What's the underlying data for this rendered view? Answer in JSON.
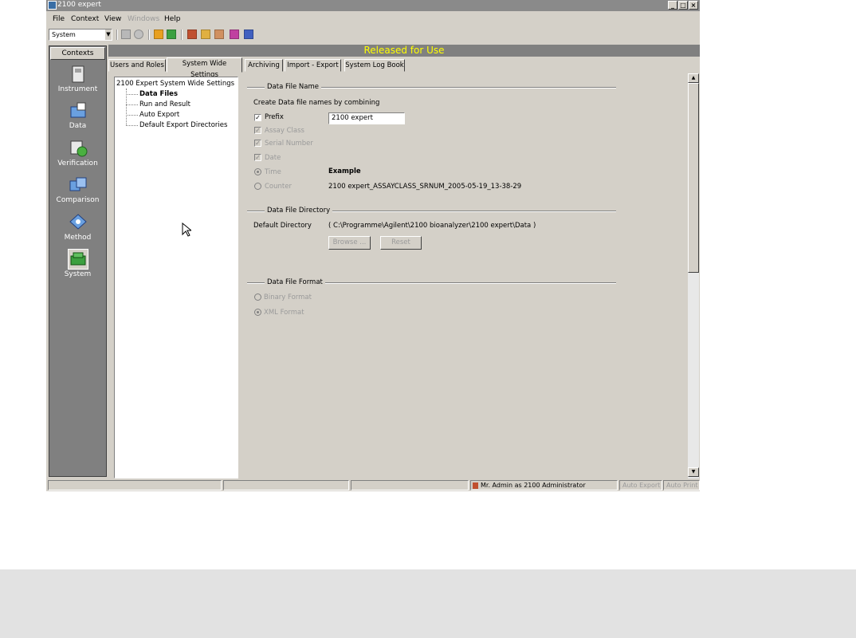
{
  "window": {
    "title": "2100 expert",
    "controls": [
      "_",
      "□",
      "×"
    ]
  },
  "menu": [
    "File",
    "Context",
    "View",
    "Windows",
    "Help"
  ],
  "toolbar": {
    "context_select": "System",
    "icons": [
      "save-icon",
      "refresh-icon",
      "lock-icon",
      "export-icon",
      "users-icon",
      "hand-icon",
      "home-icon",
      "chart-icon",
      "grid-icon"
    ]
  },
  "sidebar": {
    "header": "Contexts",
    "items": [
      {
        "label": "Instrument",
        "icon": "instrument-icon"
      },
      {
        "label": "Data",
        "icon": "data-icon"
      },
      {
        "label": "Verification",
        "icon": "verification-icon"
      },
      {
        "label": "Comparison",
        "icon": "comparison-icon"
      },
      {
        "label": "Method",
        "icon": "method-icon"
      },
      {
        "label": "System",
        "icon": "system-icon",
        "selected": true
      }
    ]
  },
  "banner": "Released for Use",
  "tabs": [
    {
      "label": "Users and Roles"
    },
    {
      "label": "System Wide Settings",
      "active": true
    },
    {
      "label": "Archiving"
    },
    {
      "label": "Import - Export"
    },
    {
      "label": "System Log Book"
    }
  ],
  "tree": {
    "root": "2100 Expert System Wide Settings",
    "children": [
      "Data Files",
      "Run and Result",
      "Auto Export",
      "Default Export Directories"
    ],
    "selected": "Data Files"
  },
  "data_file_name": {
    "group_title": "Data File Name",
    "instruction": "Create Data file names by combining",
    "prefix_label": "Prefix",
    "prefix_value": "2100 expert",
    "assay_class_label": "Assay Class",
    "serial_number_label": "Serial Number",
    "date_label": "Date",
    "time_label": "Time",
    "counter_label": "Counter",
    "example_label": "Example",
    "example_value": "2100 expert_ASSAYCLASS_SRNUM_2005-05-19_13-38-29"
  },
  "data_file_directory": {
    "group_title": "Data File Directory",
    "label": "Default Directory",
    "value": "( C:\\Programme\\Agilent\\2100 bioanalyzer\\2100 expert\\Data )",
    "browse_button": "Browse ...",
    "reset_button": "Reset"
  },
  "data_file_format": {
    "group_title": "Data File Format",
    "binary_label": "Binary Format",
    "xml_label": "XML Format"
  },
  "statusbar": {
    "user": "Mr. Admin as 2100 Administrator",
    "auto_export": "Auto Export",
    "auto_print": "Auto Print"
  }
}
